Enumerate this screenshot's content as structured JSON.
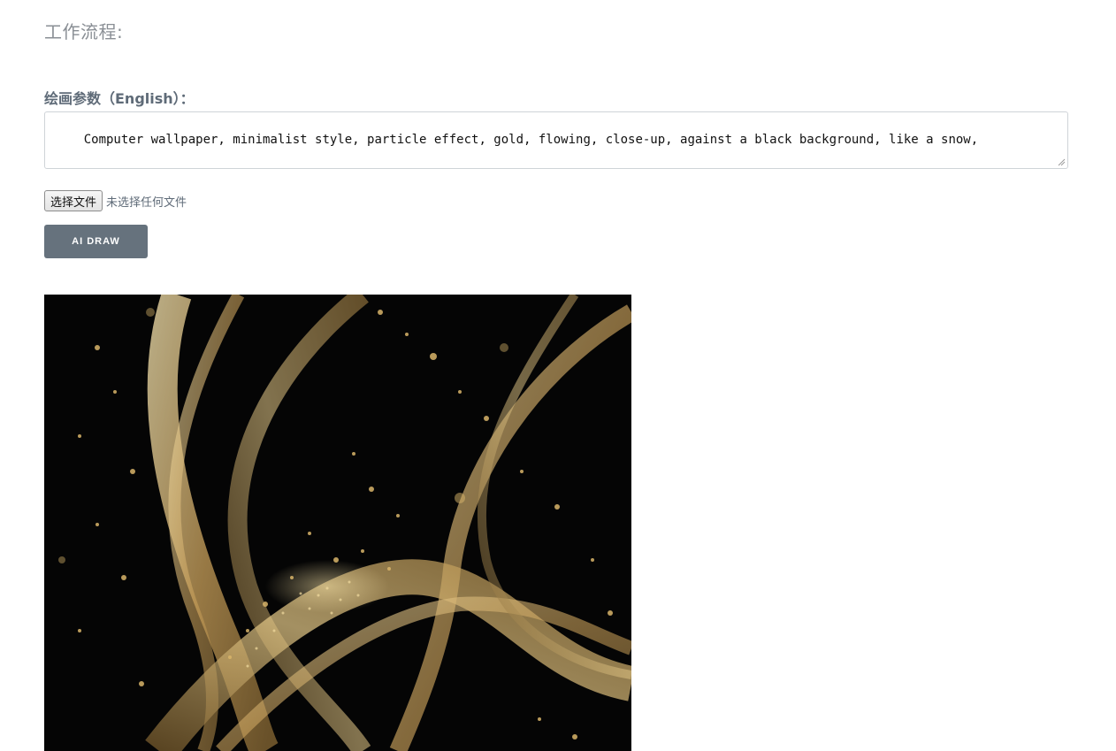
{
  "workflow": {
    "title": "工作流程:"
  },
  "params": {
    "label": "绘画参数（English）：",
    "prompt": "Computer wallpaper, minimalist style, particle effect, gold, flowing, close-up, against a black background, like a snow,"
  },
  "file_input": {
    "button_label": "选择文件",
    "status": "未选择任何文件"
  },
  "actions": {
    "draw_label": "AI DRAW"
  },
  "colors": {
    "button_bg": "#66727d",
    "label_text": "#5f6b78",
    "image_bg": "#050505",
    "gold": "#d9b56a"
  },
  "result": {
    "image_icon": "generated-artwork"
  }
}
